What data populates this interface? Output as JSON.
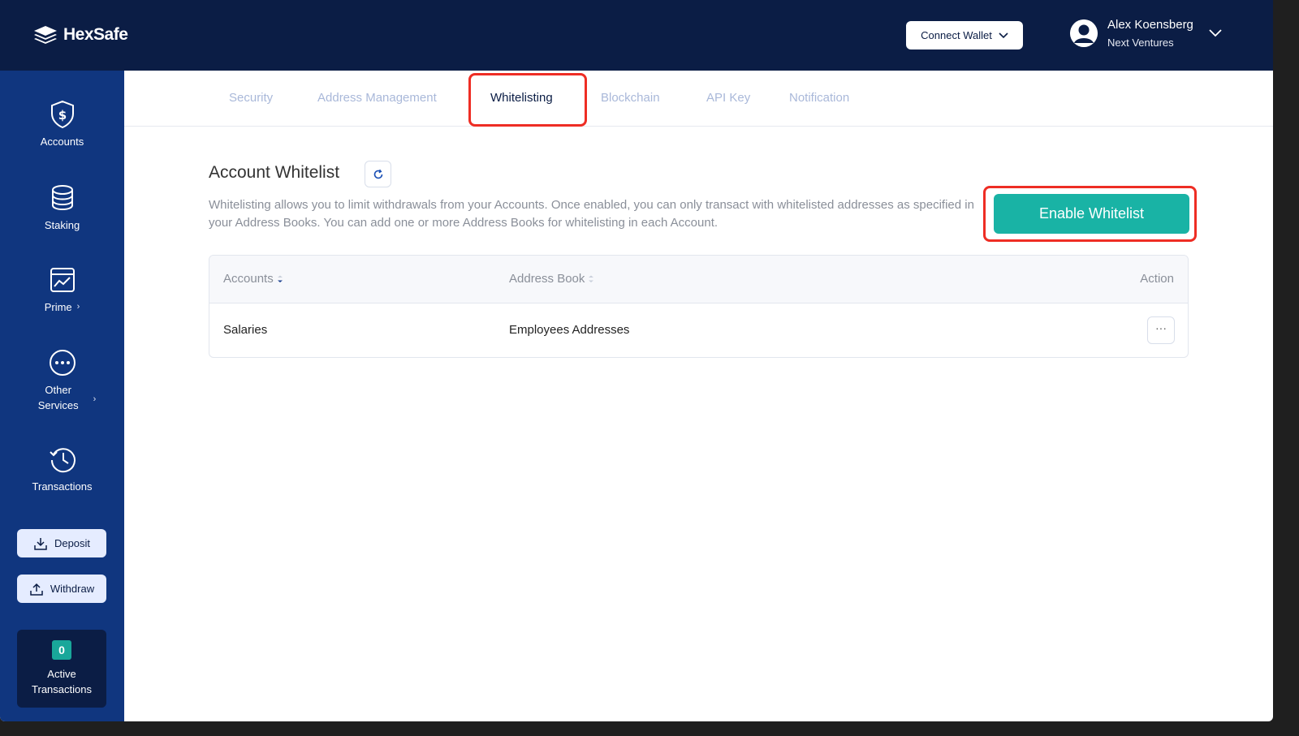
{
  "app": {
    "logo_text": "HexSafe"
  },
  "header": {
    "connect_wallet_label": "Connect Wallet",
    "user_name": "Alex Koensberg",
    "user_org": "Next Ventures"
  },
  "sidebar": {
    "items": [
      {
        "label": "Accounts",
        "icon": "shield-dollar-icon"
      },
      {
        "label": "Staking",
        "icon": "coin-stack-icon"
      },
      {
        "label": "Prime",
        "icon": "chart-window-icon"
      },
      {
        "label": "Other",
        "label2": "Services",
        "icon": "more-circle-icon"
      },
      {
        "label": "Transactions",
        "icon": "history-clock-icon"
      }
    ],
    "deposit_label": "Deposit",
    "withdraw_label": "Withdraw",
    "active_count": "0",
    "active_label_1": "Active",
    "active_label_2": "Transactions"
  },
  "tabs": [
    {
      "label": "Security"
    },
    {
      "label": "Address Management"
    },
    {
      "label": "Whitelisting",
      "active": true
    },
    {
      "label": "Blockchain"
    },
    {
      "label": "API Key"
    },
    {
      "label": "Notification"
    }
  ],
  "main": {
    "title": "Account Whitelist",
    "description": "Whitelisting allows you to limit withdrawals from your Accounts. Once enabled, you can only transact with whitelisted addresses as specified in your Address Books. You can add one or more Address Books for whitelisting in each Account.",
    "enable_button": "Enable Whitelist"
  },
  "table": {
    "columns": [
      "Accounts",
      "Address Book",
      "Action"
    ],
    "rows": [
      {
        "account": "Salaries",
        "address_book": "Employees Addresses",
        "action": "···"
      }
    ]
  },
  "colors": {
    "header_bg": "#0b1d45",
    "sidebar_bg": "#10367f",
    "accent_teal": "#19b3a5",
    "highlight_red": "#ee2d24"
  }
}
